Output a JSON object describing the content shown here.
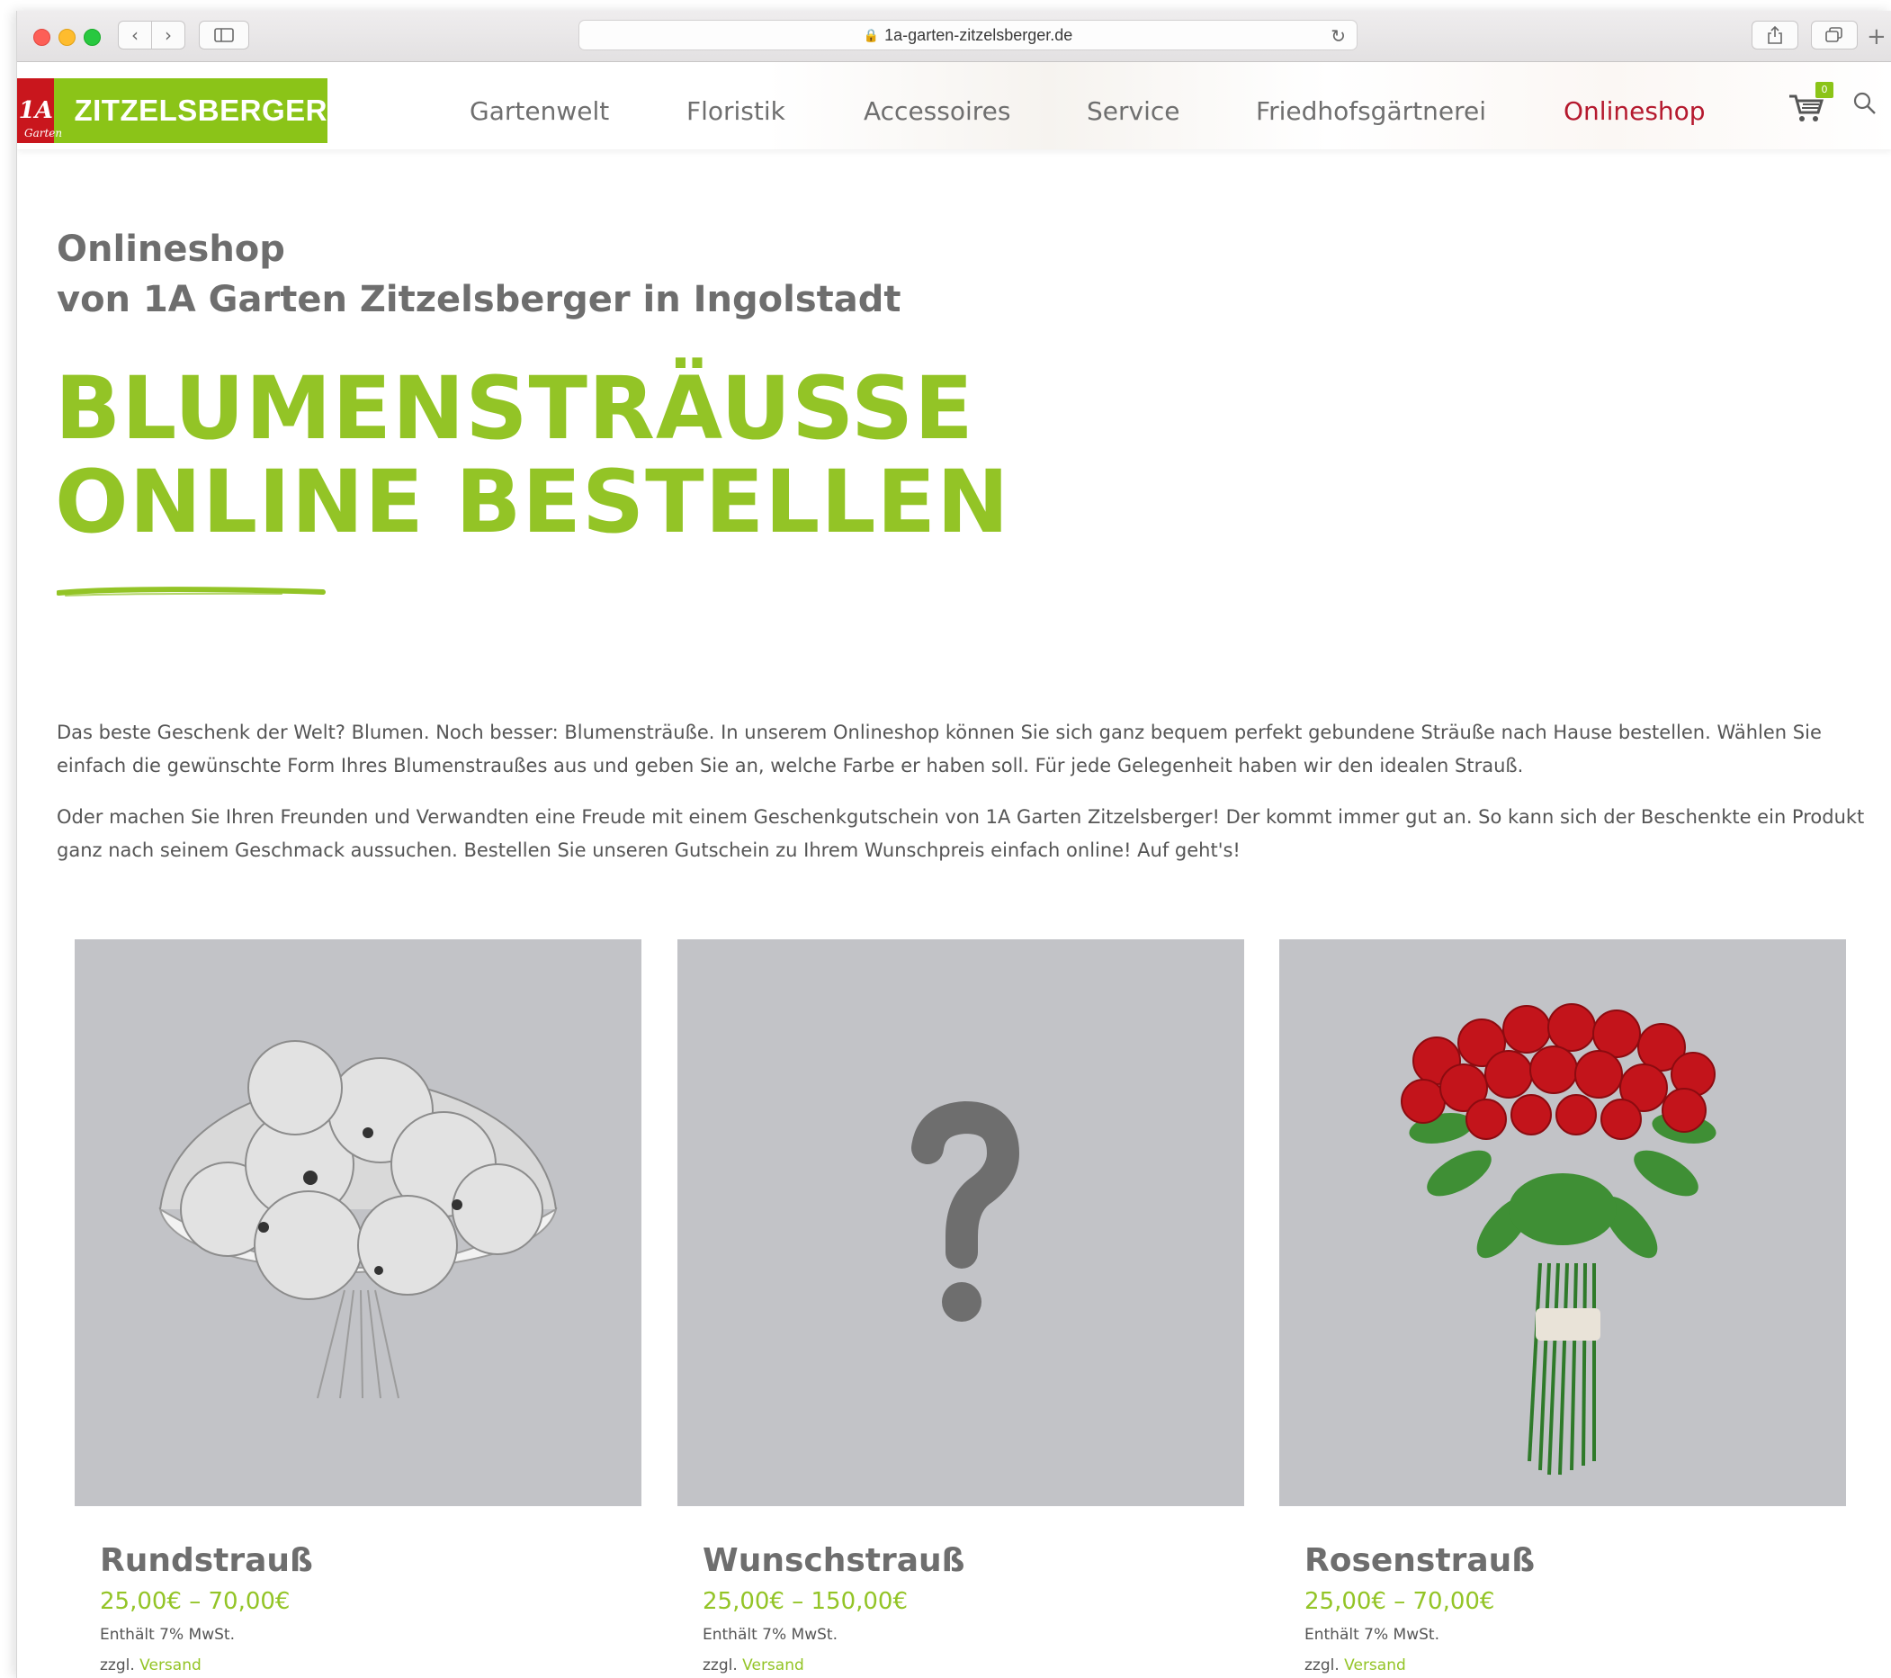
{
  "browser": {
    "url": "1a-garten-zitzelsberger.de"
  },
  "header": {
    "logo_badge": "1A",
    "logo_badge_sub": "Garten",
    "logo_text": "ZITZELSBERGER",
    "nav": [
      {
        "label": "Gartenwelt"
      },
      {
        "label": "Floristik"
      },
      {
        "label": "Accessoires"
      },
      {
        "label": "Service"
      },
      {
        "label": "Friedhofsgärtnerei"
      },
      {
        "label": "Onlineshop",
        "active": true
      }
    ],
    "cart_count": "0"
  },
  "page": {
    "subtitle_line1": "Onlineshop",
    "subtitle_line2": "von 1A Garten Zitzelsberger in Ingolstadt",
    "headline_line1": "BLUMENSTRÄUSSE",
    "headline_line2": "ONLINE BESTELLEN",
    "intro_p1": "Das beste Geschenk der Welt? Blumen. Noch besser: Blumensträuße. In unserem Onlineshop können Sie sich ganz bequem perfekt gebundene Sträuße nach Hause bestellen. Wählen Sie einfach die gewünschte Form Ihres Blumenstraußes aus und geben Sie an, welche Farbe er haben soll. Für jede Gelegenheit haben wir den idealen Strauß.",
    "intro_p2": "Oder machen Sie Ihren Freunden und Verwandten eine Freude mit einem Geschenkgutschein von 1A Garten Zitzelsberger! Der kommt immer gut an. So kann sich der Beschenkte ein Produkt ganz nach seinem Geschmack aussuchen. Bestellen Sie unseren Gutschein zu Ihrem Wunschpreis einfach online! Auf geht's!"
  },
  "products": [
    {
      "title": "Rundstrauß",
      "price": "25,00€ – 70,00€",
      "tax": "Enthält 7% MwSt.",
      "ship_prefix": "zzgl.",
      "ship_link": "Versand"
    },
    {
      "title": "Wunschstrauß",
      "price": "25,00€ – 150,00€",
      "tax": "Enthält 7% MwSt.",
      "ship_prefix": "zzgl.",
      "ship_link": "Versand"
    },
    {
      "title": "Rosenstrauß",
      "price": "25,00€ – 70,00€",
      "tax": "Enthält 7% MwSt.",
      "ship_prefix": "zzgl.",
      "ship_link": "Versand"
    }
  ],
  "colors": {
    "brand_green": "#93c426",
    "brand_red": "#c9161d",
    "active_nav": "#b5192e"
  }
}
